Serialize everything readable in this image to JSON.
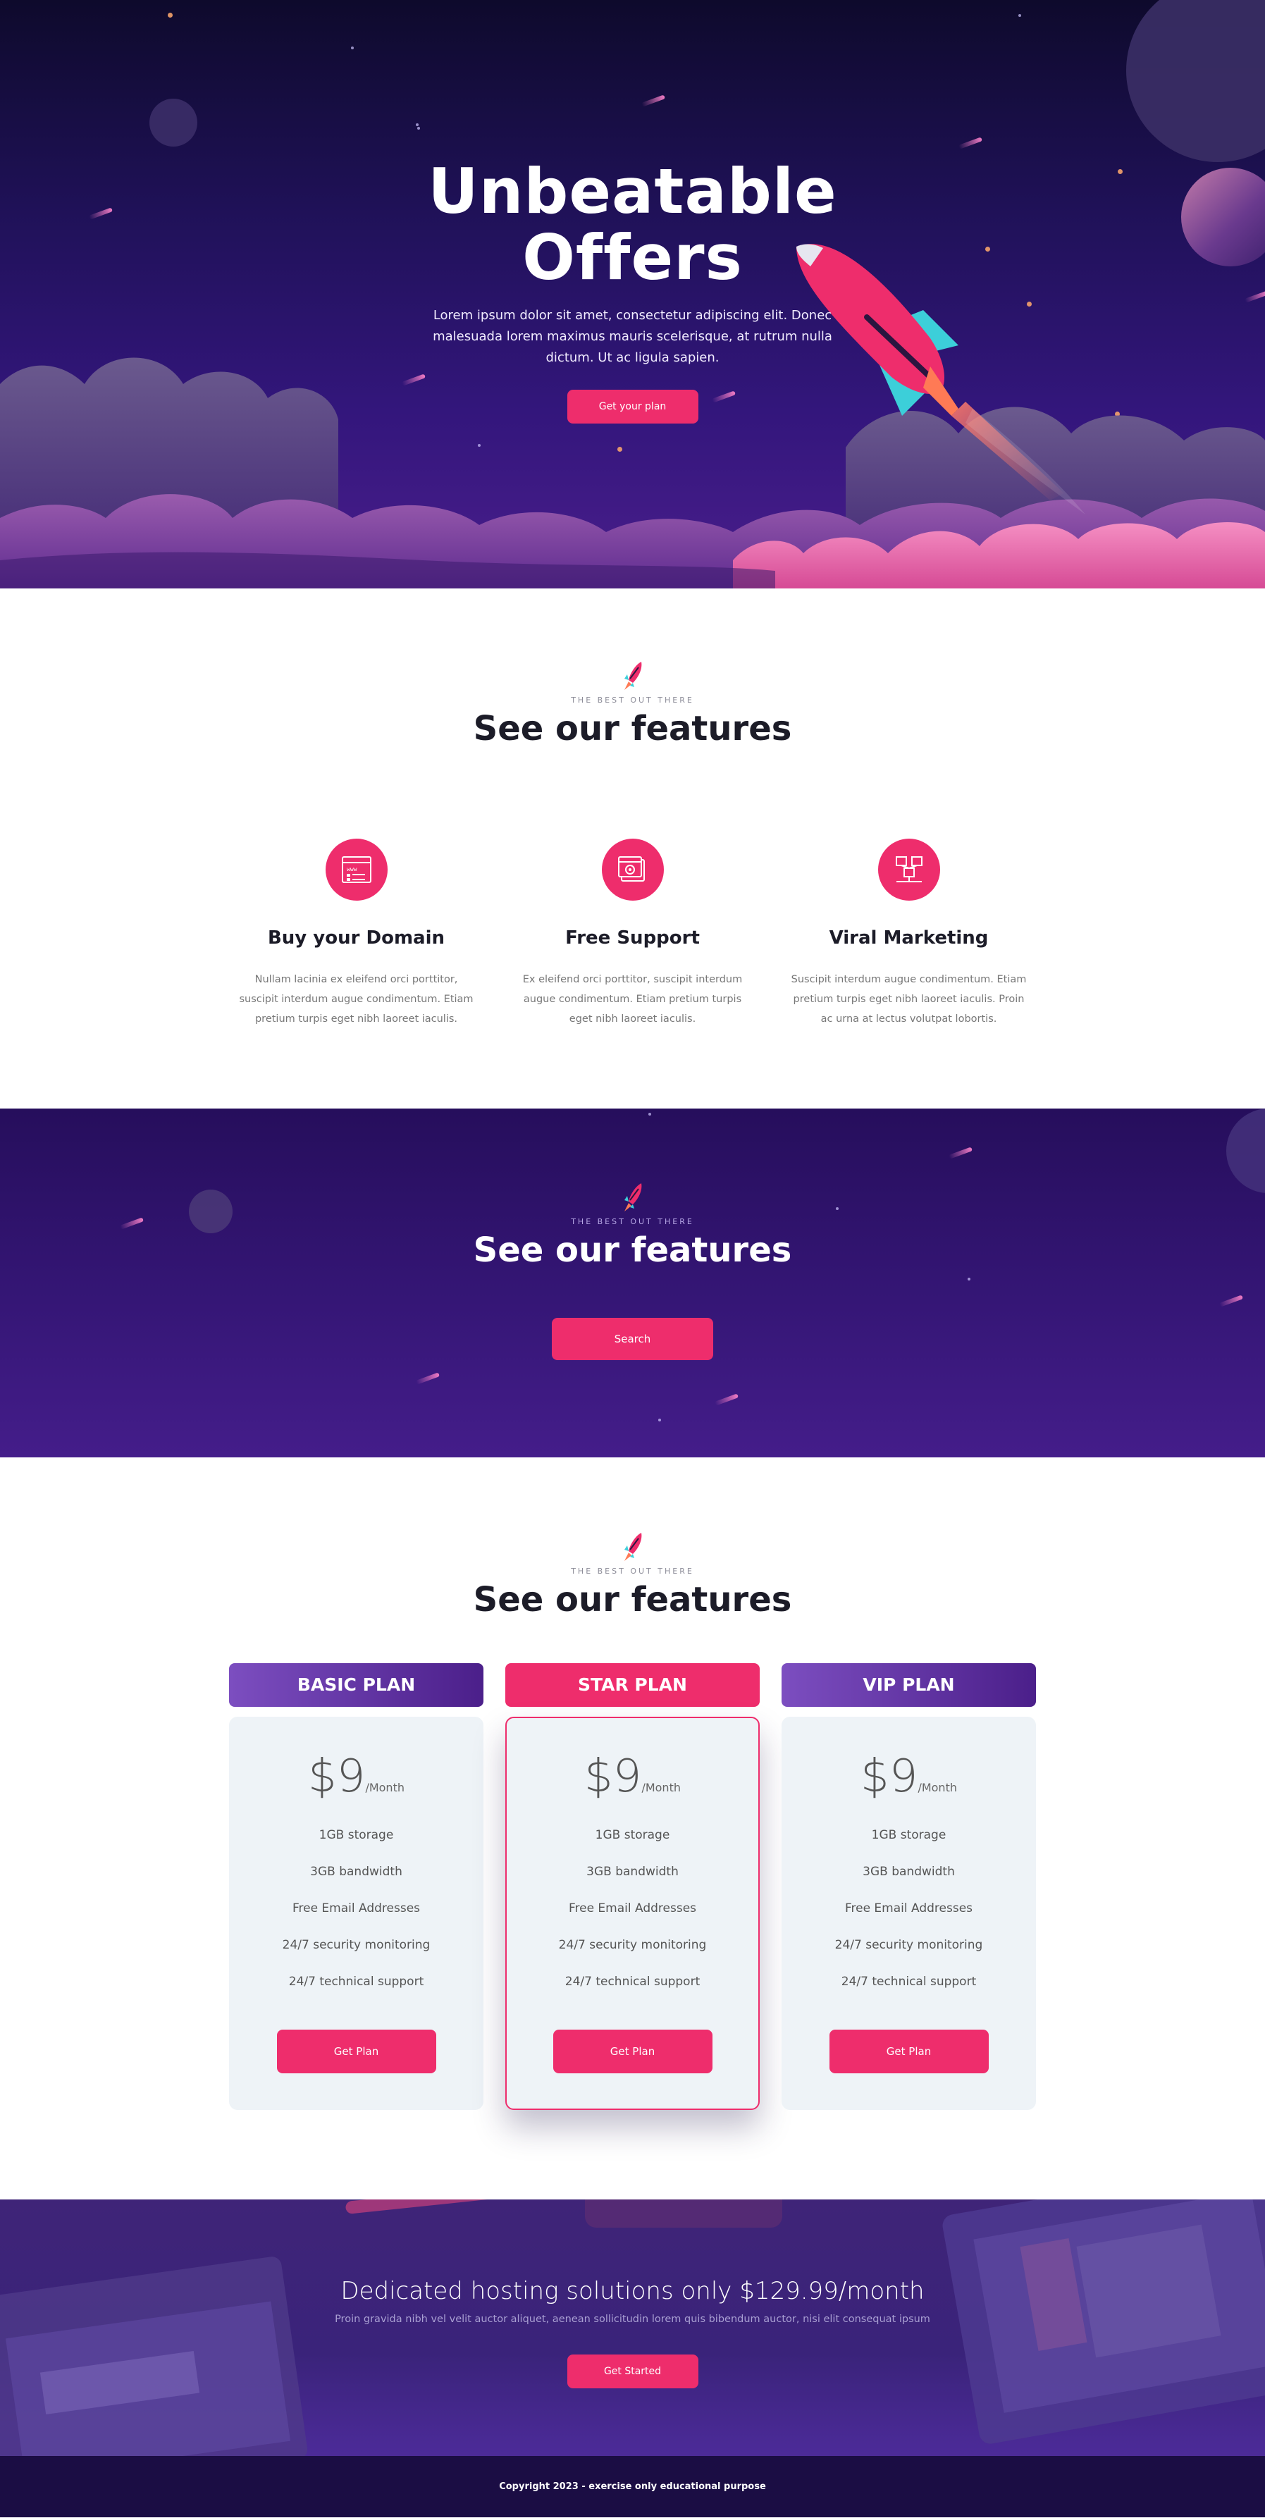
{
  "hero": {
    "title_line1": "Unbeatable",
    "title_line2": "Offers",
    "text": "Lorem ipsum dolor sit amet, consectetur adipiscing elit. Donec malesuada lorem maximus mauris scelerisque, at rutrum nulla dictum. Ut ac ligula sapien.",
    "button": "Get your plan"
  },
  "features": {
    "eyebrow": "THE BEST OUT THERE",
    "title": "See our features",
    "items": [
      {
        "icon": "browser-window-icon",
        "title": "Buy your Domain",
        "text": "Nullam lacinia ex eleifend orci porttitor, suscipit interdum augue condimentum. Etiam pretium turpis eget nibh laoreet iaculis."
      },
      {
        "icon": "settings-window-icon",
        "title": "Free Support",
        "text": "Ex eleifend orci porttitor, suscipit interdum augue condimentum. Etiam pretium turpis eget nibh laoreet iaculis."
      },
      {
        "icon": "network-icon",
        "title": "Viral Marketing",
        "text": "Suscipit interdum augue condimentum. Etiam pretium turpis eget nibh laoreet iaculis. Proin ac urna at lectus volutpat lobortis."
      }
    ]
  },
  "search_band": {
    "eyebrow": "THE BEST OUT THERE",
    "title": "See our features",
    "button": "Search"
  },
  "pricing": {
    "eyebrow": "THE BEST OUT THERE",
    "title": "See our features",
    "plans": [
      {
        "name": "BASIC PLAN",
        "price": "$9",
        "period": "/Month",
        "features": [
          "1GB storage",
          "3GB bandwidth",
          "Free Email Addresses",
          "24/7 security monitoring",
          "24/7 technical support"
        ],
        "button": "Get Plan"
      },
      {
        "name": "STAR PLAN",
        "price": "$9",
        "period": "/Month",
        "features": [
          "1GB storage",
          "3GB bandwidth",
          "Free Email Addresses",
          "24/7 security monitoring",
          "24/7 technical support"
        ],
        "button": "Get Plan"
      },
      {
        "name": "VIP PLAN",
        "price": "$9",
        "period": "/Month",
        "features": [
          "1GB storage",
          "3GB bandwidth",
          "Free Email Addresses",
          "24/7 security monitoring",
          "24/7 technical support"
        ],
        "button": "Get Plan"
      }
    ]
  },
  "cta": {
    "title": "Dedicated hosting solutions only $129.99/month",
    "text": "Proin gravida nibh vel velit auctor aliquet, aenean sollicitudin lorem quis bibendum auctor, nisi elit consequat ipsum",
    "button": "Get Started"
  },
  "footer": {
    "text": "Copyright 2023 - exercise only educational purpose"
  },
  "colors": {
    "accent": "#ee2d6c",
    "hero_bg": "#1f1157",
    "band_bg": "#351676",
    "plan_purple": "#7c4ec0",
    "footer_bg": "#1b0d44"
  }
}
